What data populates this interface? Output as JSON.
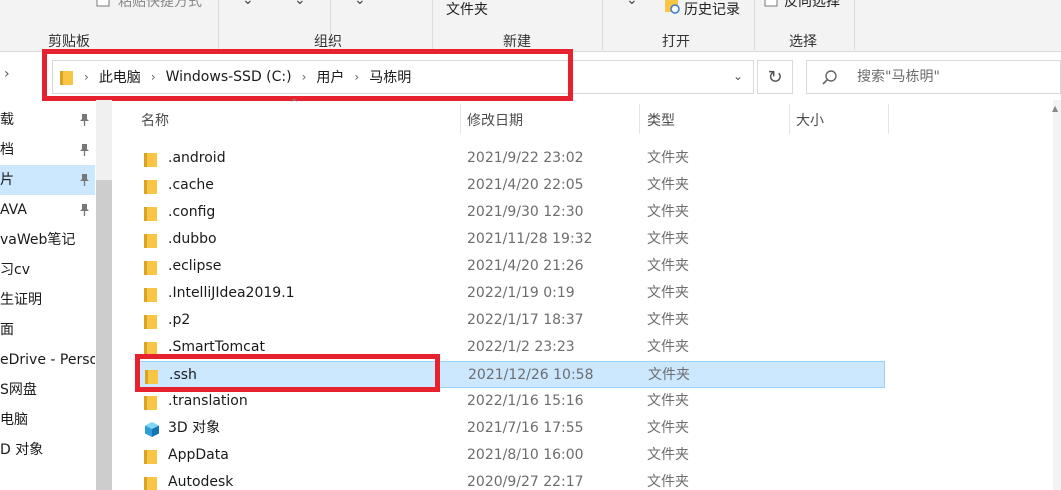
{
  "ribbon": {
    "top_labels": {
      "paste_shortcut": "粘贴快捷方式",
      "new_folder": "文件夹",
      "history": "历史记录",
      "invert_selection": "反向选择"
    },
    "groups": [
      "剪贴板",
      "组织",
      "新建",
      "打开",
      "选择"
    ]
  },
  "address_bar": {
    "crumbs": [
      "此电脑",
      "Windows-SSD (C:)",
      "用户",
      "马栋明"
    ]
  },
  "search": {
    "placeholder": "搜索\"马栋明\""
  },
  "sidebar": {
    "items": [
      {
        "label": "载",
        "pinned": true,
        "selected": false
      },
      {
        "label": "档",
        "pinned": true,
        "selected": false
      },
      {
        "label": "片",
        "pinned": true,
        "selected": true
      },
      {
        "label": "AVA",
        "pinned": true,
        "selected": false
      },
      {
        "label": "vaWeb笔记",
        "pinned": false,
        "selected": false
      },
      {
        "label": "习cv",
        "pinned": false,
        "selected": false
      },
      {
        "label": "生证明",
        "pinned": false,
        "selected": false
      },
      {
        "label": "面",
        "pinned": false,
        "selected": false
      },
      {
        "label": "eDrive - Perso",
        "pinned": false,
        "selected": false
      },
      {
        "label": "S网盘",
        "pinned": false,
        "selected": false
      },
      {
        "label": "电脑",
        "pinned": false,
        "selected": false
      },
      {
        "label": "D 对象",
        "pinned": false,
        "selected": false
      }
    ]
  },
  "columns": {
    "name": "名称",
    "date": "修改日期",
    "type": "类型",
    "size": "大小"
  },
  "files": [
    {
      "name": ".android",
      "date": "2021/9/22 23:02",
      "type": "文件夹",
      "icon": "folder-icon",
      "selected": false
    },
    {
      "name": ".cache",
      "date": "2021/4/20 22:05",
      "type": "文件夹",
      "icon": "folder-icon",
      "selected": false
    },
    {
      "name": ".config",
      "date": "2021/9/30 12:30",
      "type": "文件夹",
      "icon": "folder-icon",
      "selected": false
    },
    {
      "name": ".dubbo",
      "date": "2021/11/28 19:32",
      "type": "文件夹",
      "icon": "folder-icon",
      "selected": false
    },
    {
      "name": ".eclipse",
      "date": "2021/4/20 21:26",
      "type": "文件夹",
      "icon": "folder-icon",
      "selected": false
    },
    {
      "name": ".IntelliJIdea2019.1",
      "date": "2022/1/19 0:19",
      "type": "文件夹",
      "icon": "folder-icon",
      "selected": false
    },
    {
      "name": ".p2",
      "date": "2022/1/17 18:37",
      "type": "文件夹",
      "icon": "folder-icon",
      "selected": false
    },
    {
      "name": ".SmartTomcat",
      "date": "2022/1/2 23:23",
      "type": "文件夹",
      "icon": "folder-icon",
      "selected": false
    },
    {
      "name": ".ssh",
      "date": "2021/12/26 10:58",
      "type": "文件夹",
      "icon": "folder-icon",
      "selected": true
    },
    {
      "name": ".translation",
      "date": "2022/1/16 15:16",
      "type": "文件夹",
      "icon": "folder-icon",
      "selected": false
    },
    {
      "name": "3D 对象",
      "date": "2021/7/16 17:55",
      "type": "文件夹",
      "icon": "3d-objects-icon",
      "selected": false
    },
    {
      "name": "AppData",
      "date": "2021/8/10 16:00",
      "type": "文件夹",
      "icon": "folder-icon",
      "selected": false
    },
    {
      "name": "Autodesk",
      "date": "2020/9/27 22:17",
      "type": "文件夹",
      "icon": "folder-icon",
      "selected": false
    }
  ],
  "colors": {
    "selection": "#cce8ff",
    "annotation": "#e5222e",
    "folder": "#f8c545"
  }
}
